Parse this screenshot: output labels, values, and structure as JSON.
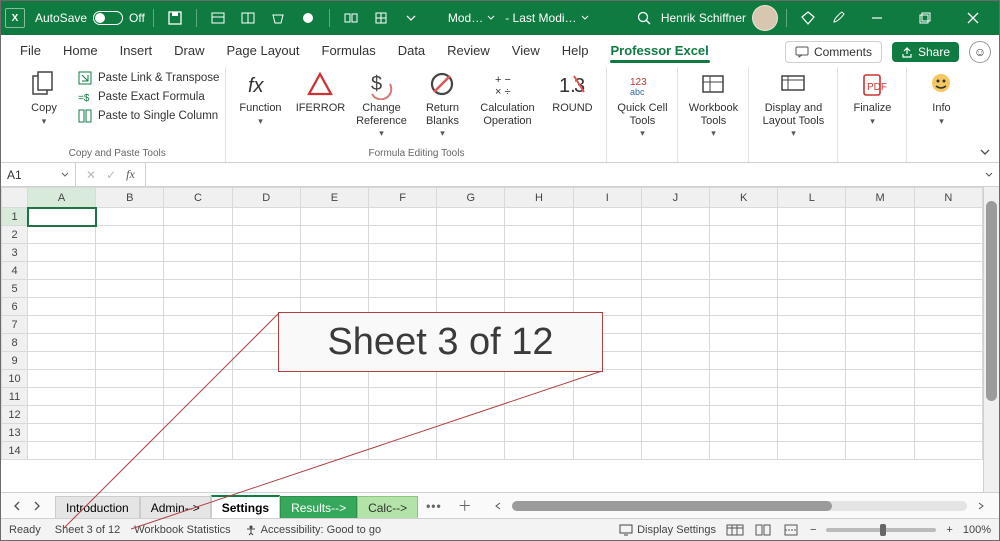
{
  "titlebar": {
    "autosave_label": "AutoSave",
    "autosave_state": "Off",
    "doc_chip1": "Mod…",
    "doc_chip2": "- Last Modi…",
    "user_name": "Henrik Schiffner"
  },
  "menu": {
    "tabs": [
      "File",
      "Home",
      "Insert",
      "Draw",
      "Page Layout",
      "Formulas",
      "Data",
      "Review",
      "View",
      "Help",
      "Professor Excel"
    ],
    "active_index": 10,
    "comments_label": "Comments",
    "share_label": "Share"
  },
  "ribbon": {
    "group1_label": "Copy and Paste Tools",
    "copy_label": "Copy",
    "paste_link_transpose": "Paste Link & Transpose",
    "paste_exact": "Paste Exact Formula",
    "paste_single_col": "Paste to Single Column",
    "group2_label": "Formula Editing Tools",
    "function_label": "Function",
    "iferror_label": "IFERROR",
    "change_ref_label": "Change Reference",
    "return_blanks_label": "Return Blanks",
    "calc_op_label": "Calculation Operation",
    "round_label": "ROUND",
    "quick_cell_label": "Quick Cell Tools",
    "workbook_tools_label": "Workbook Tools",
    "display_layout_label": "Display and Layout Tools",
    "finalize_label": "Finalize",
    "info_label": "Info"
  },
  "namebox": {
    "value": "A1"
  },
  "columns": [
    "A",
    "B",
    "C",
    "D",
    "E",
    "F",
    "G",
    "H",
    "I",
    "J",
    "K",
    "L",
    "M",
    "N"
  ],
  "rows": [
    "1",
    "2",
    "3",
    "4",
    "5",
    "6",
    "7",
    "8",
    "9",
    "10",
    "11",
    "12",
    "13",
    "14"
  ],
  "sheet_tabs": {
    "introduction": "Introduction",
    "admin": "Admin-->",
    "settings": "Settings",
    "results": "Results-->",
    "calc": "Calc-->"
  },
  "status": {
    "ready": "Ready",
    "sheet_pos": "Sheet 3 of 12",
    "wb_stats": "Workbook Statistics",
    "accessibility": "Accessibility: Good to go",
    "display_settings": "Display Settings",
    "zoom": "100%"
  },
  "callout": {
    "text": "Sheet 3 of 12"
  }
}
